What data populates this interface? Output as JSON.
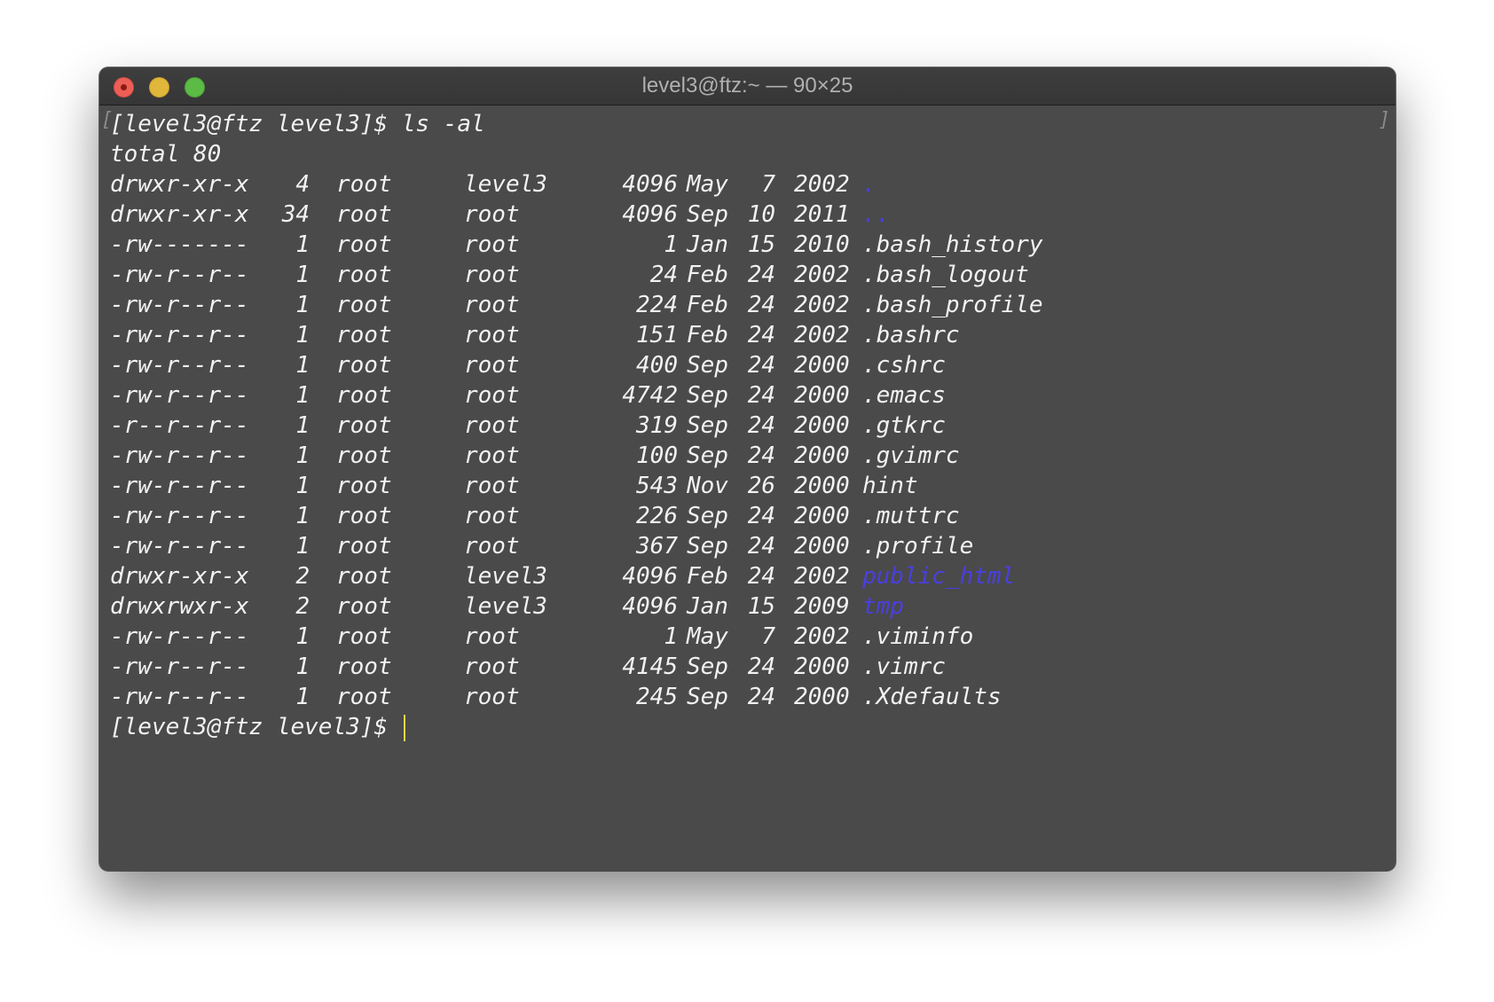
{
  "window": {
    "title": "level3@ftz:~ — 90×25"
  },
  "terminal": {
    "command_prompt": "[level3@ftz level3]$ ls -al",
    "total": "total 80",
    "entries": [
      {
        "perm": "drwxr-xr-x",
        "links": "4",
        "owner": "root",
        "group": "level3",
        "size": "4096",
        "month": "May",
        "day": "7",
        "year": "2002",
        "name": ".",
        "type": "dir"
      },
      {
        "perm": "drwxr-xr-x",
        "links": "34",
        "owner": "root",
        "group": "root",
        "size": "4096",
        "month": "Sep",
        "day": "10",
        "year": "2011",
        "name": "..",
        "type": "dir"
      },
      {
        "perm": "-rw-------",
        "links": "1",
        "owner": "root",
        "group": "root",
        "size": "1",
        "month": "Jan",
        "day": "15",
        "year": "2010",
        "name": ".bash_history",
        "type": "file"
      },
      {
        "perm": "-rw-r--r--",
        "links": "1",
        "owner": "root",
        "group": "root",
        "size": "24",
        "month": "Feb",
        "day": "24",
        "year": "2002",
        "name": ".bash_logout",
        "type": "file"
      },
      {
        "perm": "-rw-r--r--",
        "links": "1",
        "owner": "root",
        "group": "root",
        "size": "224",
        "month": "Feb",
        "day": "24",
        "year": "2002",
        "name": ".bash_profile",
        "type": "file"
      },
      {
        "perm": "-rw-r--r--",
        "links": "1",
        "owner": "root",
        "group": "root",
        "size": "151",
        "month": "Feb",
        "day": "24",
        "year": "2002",
        "name": ".bashrc",
        "type": "file"
      },
      {
        "perm": "-rw-r--r--",
        "links": "1",
        "owner": "root",
        "group": "root",
        "size": "400",
        "month": "Sep",
        "day": "24",
        "year": "2000",
        "name": ".cshrc",
        "type": "file"
      },
      {
        "perm": "-rw-r--r--",
        "links": "1",
        "owner": "root",
        "group": "root",
        "size": "4742",
        "month": "Sep",
        "day": "24",
        "year": "2000",
        "name": ".emacs",
        "type": "file"
      },
      {
        "perm": "-r--r--r--",
        "links": "1",
        "owner": "root",
        "group": "root",
        "size": "319",
        "month": "Sep",
        "day": "24",
        "year": "2000",
        "name": ".gtkrc",
        "type": "file"
      },
      {
        "perm": "-rw-r--r--",
        "links": "1",
        "owner": "root",
        "group": "root",
        "size": "100",
        "month": "Sep",
        "day": "24",
        "year": "2000",
        "name": ".gvimrc",
        "type": "file"
      },
      {
        "perm": "-rw-r--r--",
        "links": "1",
        "owner": "root",
        "group": "root",
        "size": "543",
        "month": "Nov",
        "day": "26",
        "year": "2000",
        "name": "hint",
        "type": "file"
      },
      {
        "perm": "-rw-r--r--",
        "links": "1",
        "owner": "root",
        "group": "root",
        "size": "226",
        "month": "Sep",
        "day": "24",
        "year": "2000",
        "name": ".muttrc",
        "type": "file"
      },
      {
        "perm": "-rw-r--r--",
        "links": "1",
        "owner": "root",
        "group": "root",
        "size": "367",
        "month": "Sep",
        "day": "24",
        "year": "2000",
        "name": ".profile",
        "type": "file"
      },
      {
        "perm": "drwxr-xr-x",
        "links": "2",
        "owner": "root",
        "group": "level3",
        "size": "4096",
        "month": "Feb",
        "day": "24",
        "year": "2002",
        "name": "public_html",
        "type": "dir"
      },
      {
        "perm": "drwxrwxr-x",
        "links": "2",
        "owner": "root",
        "group": "level3",
        "size": "4096",
        "month": "Jan",
        "day": "15",
        "year": "2009",
        "name": "tmp",
        "type": "dir"
      },
      {
        "perm": "-rw-r--r--",
        "links": "1",
        "owner": "root",
        "group": "root",
        "size": "1",
        "month": "May",
        "day": "7",
        "year": "2002",
        "name": ".viminfo",
        "type": "file"
      },
      {
        "perm": "-rw-r--r--",
        "links": "1",
        "owner": "root",
        "group": "root",
        "size": "4145",
        "month": "Sep",
        "day": "24",
        "year": "2000",
        "name": ".vimrc",
        "type": "file"
      },
      {
        "perm": "-rw-r--r--",
        "links": "1",
        "owner": "root",
        "group": "root",
        "size": "245",
        "month": "Sep",
        "day": "24",
        "year": "2000",
        "name": ".Xdefaults",
        "type": "file"
      }
    ],
    "final_prompt": "[level3@ftz level3]$ "
  },
  "colors": {
    "background": "#4a4a4a",
    "text": "#f2f2f2",
    "directory": "#4a3fe0",
    "cursor": "#e8d84a"
  }
}
